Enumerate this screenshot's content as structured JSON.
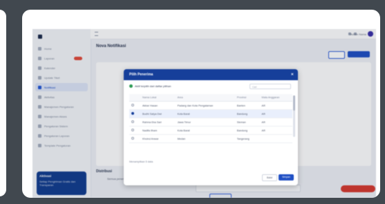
{
  "app": {
    "page_title": "Nova Notifikasi",
    "user_name": "Admin Nama"
  },
  "sidebar": {
    "items": [
      {
        "label": "Home"
      },
      {
        "label": "Laporan"
      },
      {
        "label": "Kalender"
      },
      {
        "label": "Update Tiket"
      },
      {
        "label": "Notifikasi"
      },
      {
        "label": "Aktivitas"
      },
      {
        "label": "Manajemen Pengaturan"
      },
      {
        "label": "Manajemen Akses"
      },
      {
        "label": "Pengaturan Sistem"
      },
      {
        "label": "Pengaturan Laporan"
      },
      {
        "label": "Template Pengaturan"
      }
    ],
    "promo": {
      "title": "Aktivasi",
      "text": "Setiap Pengiriman Gratis dan Transparan"
    }
  },
  "background": {
    "section_title": "Distribusi",
    "radio_label": "Semua penerima",
    "field_placeholder": "Cari penerima"
  },
  "modal": {
    "title": "Pilih Penerima",
    "filter_label": "Aktif terpilih dari daftar pilihan",
    "search_placeholder": "Cari",
    "columns": [
      "Nama Lokal",
      "Area",
      "Provinsi",
      "Mata Anggaran"
    ],
    "rows": [
      {
        "name": "Akbar Hasan",
        "area": "Padang dan Kota Pengalaman",
        "prov": "Banten",
        "code": "AR",
        "selected": false
      },
      {
        "name": "Budhi Satya Dwi",
        "area": "Kota Barat",
        "prov": "Bandung",
        "code": "AR",
        "selected": true
      },
      {
        "name": "Rahma Eka Sari",
        "area": "Jawa Timur",
        "prov": "Sleman",
        "code": "AR",
        "selected": false
      },
      {
        "name": "Nadifa Ilham",
        "area": "Kota Barat",
        "prov": "Bandung",
        "code": "AR",
        "selected": false
      },
      {
        "name": "Khoirul Anwar",
        "area": "Medan",
        "prov": "Tangerang",
        "code": "",
        "selected": false
      }
    ],
    "note": "Menampilkan 5 data",
    "cancel_label": "Batal",
    "ok_label": "Simpan"
  }
}
